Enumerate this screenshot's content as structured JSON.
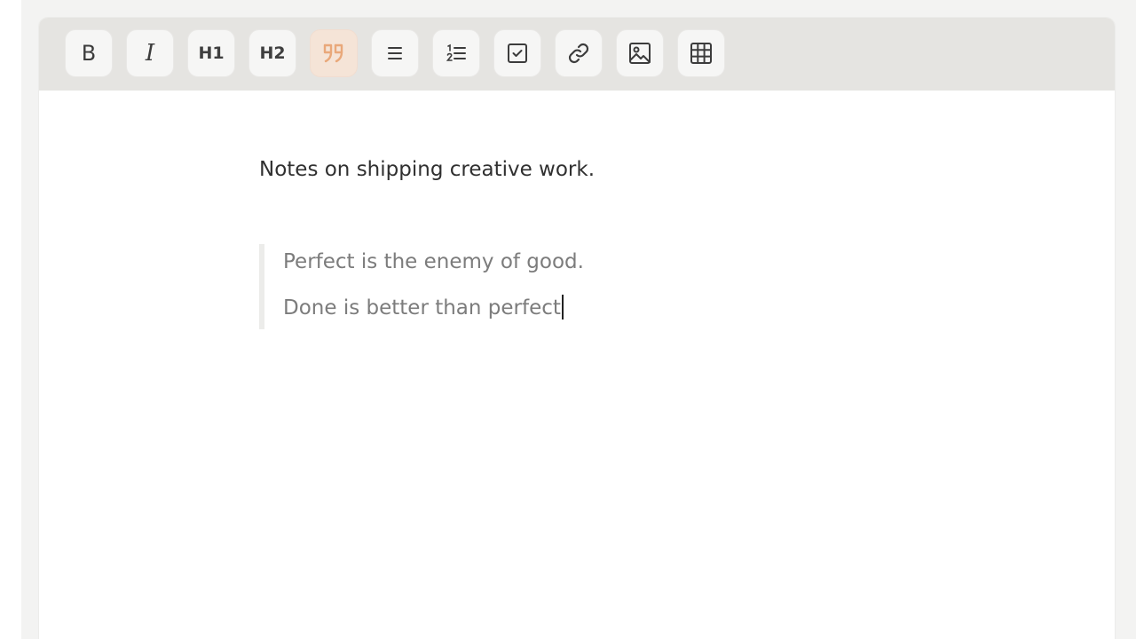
{
  "toolbar": {
    "bold_label": "B",
    "italic_label": "I",
    "h1_label": "H1",
    "h2_label": "H2",
    "active_tool": "blockquote",
    "accent_color": "#e9a87a",
    "icons": [
      "bold",
      "italic",
      "heading-1",
      "heading-2",
      "quote-icon",
      "bullet-list-icon",
      "numbered-list-icon",
      "checkbox-icon",
      "link-icon",
      "image-icon",
      "table-icon"
    ]
  },
  "document": {
    "paragraph": "Notes on shipping creative work.",
    "quote_lines": [
      "Perfect is the enemy of good.",
      "Done is better than perfect"
    ]
  }
}
